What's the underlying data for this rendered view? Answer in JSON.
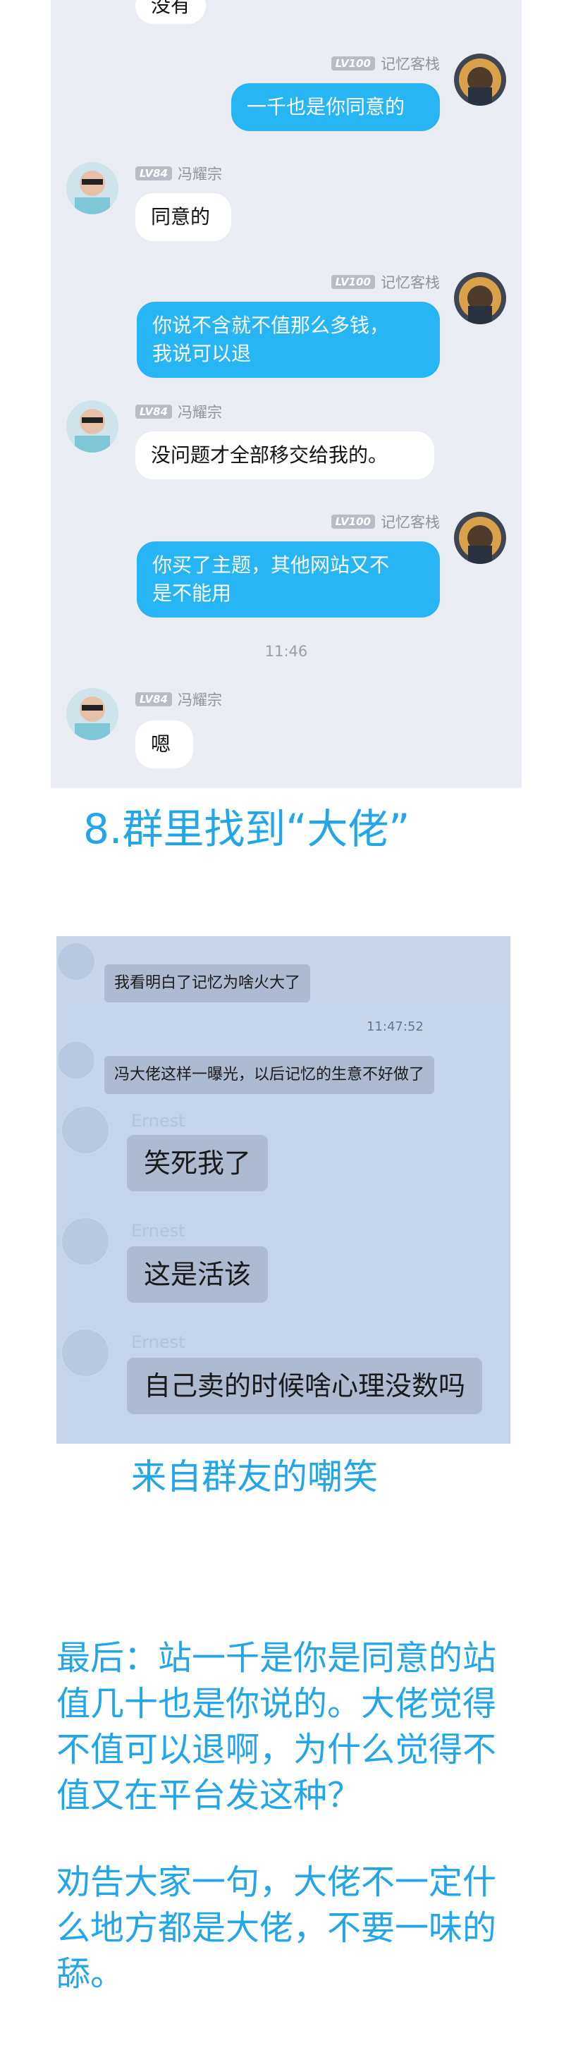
{
  "chat1": {
    "top_bubble": "没有",
    "messages": [
      {
        "sender": "记忆客栈",
        "level": "LV100",
        "text": "一千也是你同意的"
      },
      {
        "sender": "冯耀宗",
        "level": "LV84",
        "text": "同意的"
      },
      {
        "sender": "记忆客栈",
        "level": "LV100",
        "text": "你说不含就不值那么多钱，\n我说可以退"
      },
      {
        "sender": "冯耀宗",
        "level": "LV84",
        "text": "没问题才全部移交给我的。"
      },
      {
        "sender": "记忆客栈",
        "level": "LV100",
        "text": "你买了主题，其他网站又不\n是不能用"
      },
      {
        "sender": "冯耀宗",
        "level": "LV84",
        "text": "嗯"
      }
    ],
    "timestamp": "11:46"
  },
  "caption1": "8.群里找到“大佬”",
  "chat2": {
    "messages": [
      {
        "text": "我看明白了记忆为啥火大了"
      },
      {
        "text": "冯大佬这样一曝光，以后记忆的生意不好做了"
      },
      {
        "text": "笑死我了"
      },
      {
        "text": "这是活该"
      },
      {
        "text": "自己卖的时候啥心理没数吗"
      }
    ],
    "timestamp": "11:47:52",
    "ghost_name": "Ernest"
  },
  "caption2": "来自群友的嘲笑",
  "closing": {
    "para1": "最后：站一千是你是同意的站值几十也是你说的。大佬觉得不值可以退啊，为什么觉得不值又在平台发这种？",
    "para2": "劝告大家一句，大佬不一定什么地方都是大佬，不要一味的舔。"
  },
  "colors": {
    "accent": "#22a6e8",
    "out_bubble": "#27b5f5",
    "panel": "#ebedf5"
  }
}
